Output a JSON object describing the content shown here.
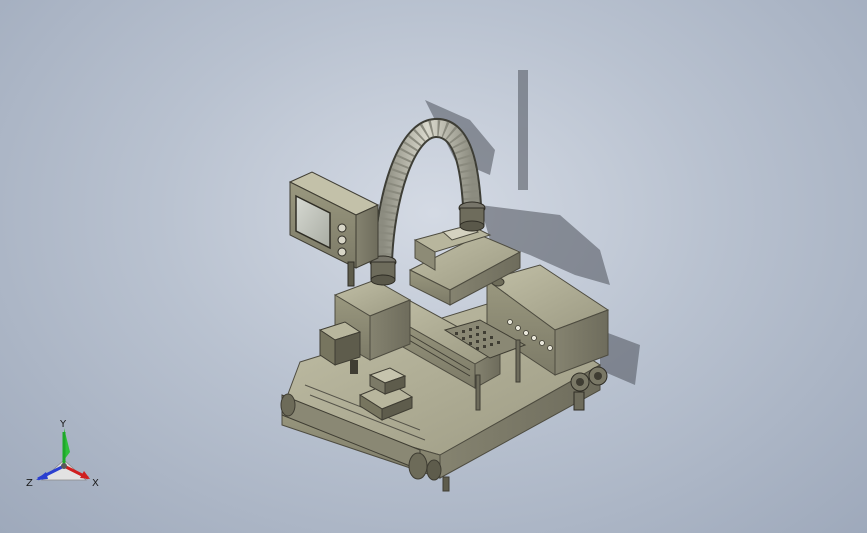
{
  "viewport": {
    "background_top": "#d4dae4",
    "background_bottom": "#9ea9bb",
    "model_color": "#a9a78f",
    "model_dark": "#6f6d5a",
    "shadow_color": "#4a4e56"
  },
  "triad": {
    "x_label": "X",
    "y_label": "Y",
    "z_label": "Z",
    "x_color": "#d01f1f",
    "y_color": "#1fa82a",
    "z_color": "#2a3fd0"
  }
}
